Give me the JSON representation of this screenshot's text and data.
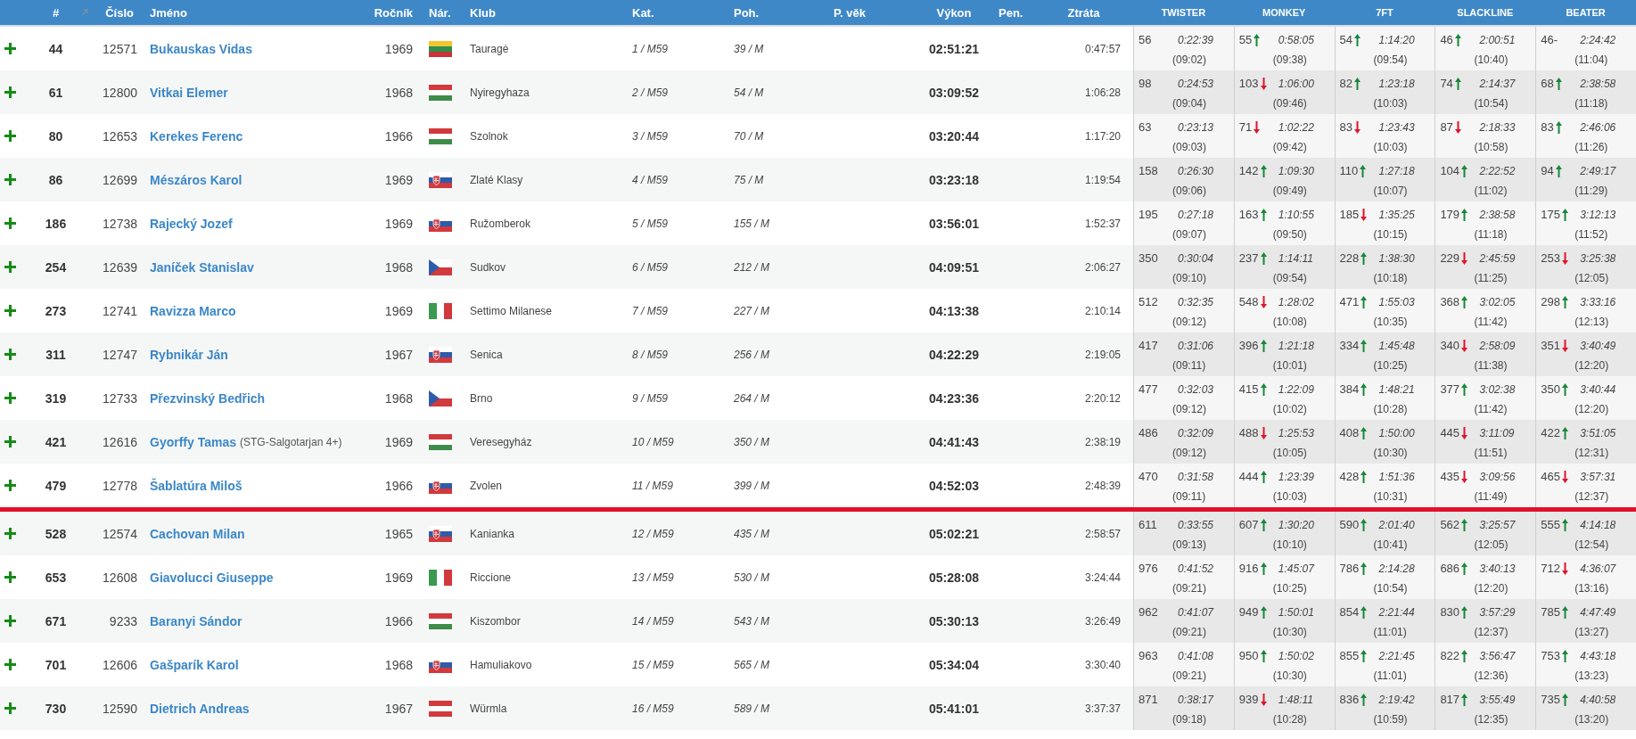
{
  "columns": [
    "#",
    "Číslo",
    "Jméno",
    "Ročník",
    "Nár.",
    "Klub",
    "Kat.",
    "Poh.",
    "P. věk",
    "Výkon",
    "Pen.",
    "Ztráta"
  ],
  "checkpoints": [
    "TWISTER",
    "MONKEY",
    "7FT",
    "SLACKLINE",
    "BEATER"
  ],
  "rows": [
    {
      "kind": "athlete",
      "place": "44",
      "number": "12571",
      "name": "Bukauskas Vidas",
      "year": "1969",
      "flag": {
        "kind": "lithuania"
      },
      "club": "Tauragė",
      "category": "1 / M59",
      "gender": "39 / M",
      "performance": "02:51:21",
      "loss": "0:47:57",
      "splits": [
        {
          "kind": "plain",
          "rank": "56",
          "time": "0:22:39",
          "clock": "(09:02)"
        },
        {
          "kind": "rise",
          "rank": "55",
          "time": "0:58:05",
          "clock": "(09:38)"
        },
        {
          "kind": "rise",
          "rank": "54",
          "time": "1:14:20",
          "clock": "(09:54)"
        },
        {
          "kind": "rise",
          "rank": "46",
          "time": "2:00:51",
          "clock": "(10:40)"
        },
        {
          "kind": "plain",
          "rank": "46-",
          "time": "2:24:42",
          "clock": "(11:04)"
        }
      ]
    },
    {
      "kind": "athlete",
      "place": "61",
      "number": "12800",
      "name": "Vitkai Elemer",
      "year": "1968",
      "flag": {
        "kind": "hungary"
      },
      "club": "Nyiregyhaza",
      "category": "2 / M59",
      "gender": "54 / M",
      "performance": "03:09:52",
      "loss": "1:06:28",
      "splits": [
        {
          "kind": "plain",
          "rank": "98",
          "time": "0:24:53",
          "clock": "(09:04)"
        },
        {
          "kind": "fall",
          "rank": "103",
          "time": "1:06:00",
          "clock": "(09:46)"
        },
        {
          "kind": "rise",
          "rank": "82",
          "time": "1:23:18",
          "clock": "(10:03)"
        },
        {
          "kind": "rise",
          "rank": "74",
          "time": "2:14:37",
          "clock": "(10:54)"
        },
        {
          "kind": "rise",
          "rank": "68",
          "time": "2:38:58",
          "clock": "(11:18)"
        }
      ]
    },
    {
      "kind": "athlete",
      "place": "80",
      "number": "12653",
      "name": "Kerekes Ferenc",
      "year": "1966",
      "flag": {
        "kind": "hungary"
      },
      "club": "Szolnok",
      "category": "3 / M59",
      "gender": "70 / M",
      "performance": "03:20:44",
      "loss": "1:17:20",
      "splits": [
        {
          "kind": "plain",
          "rank": "63",
          "time": "0:23:13",
          "clock": "(09:03)"
        },
        {
          "kind": "fall",
          "rank": "71",
          "time": "1:02:22",
          "clock": "(09:42)"
        },
        {
          "kind": "fall",
          "rank": "83",
          "time": "1:23:43",
          "clock": "(10:03)"
        },
        {
          "kind": "fall",
          "rank": "87",
          "time": "2:18:33",
          "clock": "(10:58)"
        },
        {
          "kind": "rise",
          "rank": "83",
          "time": "2:46:06",
          "clock": "(11:26)"
        }
      ]
    },
    {
      "kind": "athlete",
      "place": "86",
      "number": "12699",
      "name": "Mészáros Karol",
      "year": "1969",
      "flag": {
        "kind": "slovakia"
      },
      "club": "Zlaté Klasy",
      "category": "4 / M59",
      "gender": "75 / M",
      "performance": "03:23:18",
      "loss": "1:19:54",
      "splits": [
        {
          "kind": "plain",
          "rank": "158",
          "time": "0:26:30",
          "clock": "(09:06)"
        },
        {
          "kind": "rise",
          "rank": "142",
          "time": "1:09:30",
          "clock": "(09:49)"
        },
        {
          "kind": "rise",
          "rank": "110",
          "time": "1:27:18",
          "clock": "(10:07)"
        },
        {
          "kind": "rise",
          "rank": "104",
          "time": "2:22:52",
          "clock": "(11:02)"
        },
        {
          "kind": "rise",
          "rank": "94",
          "time": "2:49:17",
          "clock": "(11:29)"
        }
      ]
    },
    {
      "kind": "athlete",
      "place": "186",
      "number": "12738",
      "name": "Rajecký Jozef",
      "year": "1969",
      "flag": {
        "kind": "slovakia"
      },
      "club": "Ružomberok",
      "category": "5 / M59",
      "gender": "155 / M",
      "performance": "03:56:01",
      "loss": "1:52:37",
      "splits": [
        {
          "kind": "plain",
          "rank": "195",
          "time": "0:27:18",
          "clock": "(09:07)"
        },
        {
          "kind": "rise",
          "rank": "163",
          "time": "1:10:55",
          "clock": "(09:50)"
        },
        {
          "kind": "fall",
          "rank": "185",
          "time": "1:35:25",
          "clock": "(10:15)"
        },
        {
          "kind": "rise",
          "rank": "179",
          "time": "2:38:58",
          "clock": "(11:18)"
        },
        {
          "kind": "rise",
          "rank": "175",
          "time": "3:12:13",
          "clock": "(11:52)"
        }
      ]
    },
    {
      "kind": "athlete",
      "place": "254",
      "number": "12639",
      "name": "Janíček Stanislav",
      "year": "1968",
      "flag": {
        "kind": "czechia"
      },
      "club": "Sudkov",
      "category": "6 / M59",
      "gender": "212 / M",
      "performance": "04:09:51",
      "loss": "2:06:27",
      "splits": [
        {
          "kind": "plain",
          "rank": "350",
          "time": "0:30:04",
          "clock": "(09:10)"
        },
        {
          "kind": "rise",
          "rank": "237",
          "time": "1:14:11",
          "clock": "(09:54)"
        },
        {
          "kind": "rise",
          "rank": "228",
          "time": "1:38:30",
          "clock": "(10:18)"
        },
        {
          "kind": "fall",
          "rank": "229",
          "time": "2:45:59",
          "clock": "(11:25)"
        },
        {
          "kind": "fall",
          "rank": "253",
          "time": "3:25:38",
          "clock": "(12:05)"
        }
      ]
    },
    {
      "kind": "athlete",
      "place": "273",
      "number": "12741",
      "name": "Ravizza Marco",
      "year": "1969",
      "flag": {
        "kind": "italy"
      },
      "club": "Settimo Milanese",
      "category": "7 / M59",
      "gender": "227 / M",
      "performance": "04:13:38",
      "loss": "2:10:14",
      "splits": [
        {
          "kind": "plain",
          "rank": "512",
          "time": "0:32:35",
          "clock": "(09:12)"
        },
        {
          "kind": "fall",
          "rank": "548",
          "time": "1:28:02",
          "clock": "(10:08)"
        },
        {
          "kind": "rise",
          "rank": "471",
          "time": "1:55:03",
          "clock": "(10:35)"
        },
        {
          "kind": "rise",
          "rank": "368",
          "time": "3:02:05",
          "clock": "(11:42)"
        },
        {
          "kind": "rise",
          "rank": "298",
          "time": "3:33:16",
          "clock": "(12:13)"
        }
      ]
    },
    {
      "kind": "athlete",
      "place": "311",
      "number": "12747",
      "name": "Rybnikár Ján",
      "year": "1967",
      "flag": {
        "kind": "slovakia"
      },
      "club": "Senica",
      "category": "8 / M59",
      "gender": "256 / M",
      "performance": "04:22:29",
      "loss": "2:19:05",
      "splits": [
        {
          "kind": "plain",
          "rank": "417",
          "time": "0:31:06",
          "clock": "(09:11)"
        },
        {
          "kind": "rise",
          "rank": "396",
          "time": "1:21:18",
          "clock": "(10:01)"
        },
        {
          "kind": "rise",
          "rank": "334",
          "time": "1:45:48",
          "clock": "(10:25)"
        },
        {
          "kind": "fall",
          "rank": "340",
          "time": "2:58:09",
          "clock": "(11:38)"
        },
        {
          "kind": "fall",
          "rank": "351",
          "time": "3:40:49",
          "clock": "(12:20)"
        }
      ]
    },
    {
      "kind": "athlete",
      "place": "319",
      "number": "12733",
      "name": "Přezvinský Bedřich",
      "year": "1968",
      "flag": {
        "kind": "czechia"
      },
      "club": "Brno",
      "category": "9 / M59",
      "gender": "264 / M",
      "performance": "04:23:36",
      "loss": "2:20:12",
      "splits": [
        {
          "kind": "plain",
          "rank": "477",
          "time": "0:32:03",
          "clock": "(09:12)"
        },
        {
          "kind": "rise",
          "rank": "415",
          "time": "1:22:09",
          "clock": "(10:02)"
        },
        {
          "kind": "rise",
          "rank": "384",
          "time": "1:48:21",
          "clock": "(10:28)"
        },
        {
          "kind": "rise",
          "rank": "377",
          "time": "3:02:38",
          "clock": "(11:42)"
        },
        {
          "kind": "rise",
          "rank": "350",
          "time": "3:40:44",
          "clock": "(12:20)"
        }
      ]
    },
    {
      "kind": "athlete",
      "place": "421",
      "number": "12616",
      "name": "Gyorffy Tamas",
      "team": "(STG-Salgotarjan 4+)",
      "year": "1969",
      "flag": {
        "kind": "hungary"
      },
      "club": "Veresegyház",
      "category": "10 / M59",
      "gender": "350 / M",
      "performance": "04:41:43",
      "loss": "2:38:19",
      "splits": [
        {
          "kind": "plain",
          "rank": "486",
          "time": "0:32:09",
          "clock": "(09:12)"
        },
        {
          "kind": "fall",
          "rank": "488",
          "time": "1:25:53",
          "clock": "(10:05)"
        },
        {
          "kind": "rise",
          "rank": "408",
          "time": "1:50:00",
          "clock": "(10:30)"
        },
        {
          "kind": "fall",
          "rank": "445",
          "time": "3:11:09",
          "clock": "(11:51)"
        },
        {
          "kind": "rise",
          "rank": "422",
          "time": "3:51:05",
          "clock": "(12:31)"
        }
      ]
    },
    {
      "kind": "athlete",
      "place": "479",
      "number": "12778",
      "name": "Šablatúra Miloš",
      "year": "1966",
      "flag": {
        "kind": "slovakia"
      },
      "club": "Zvolen",
      "category": "11 / M59",
      "gender": "399 / M",
      "performance": "04:52:03",
      "loss": "2:48:39",
      "splits": [
        {
          "kind": "plain",
          "rank": "470",
          "time": "0:31:58",
          "clock": "(09:11)"
        },
        {
          "kind": "rise",
          "rank": "444",
          "time": "1:23:39",
          "clock": "(10:03)"
        },
        {
          "kind": "rise",
          "rank": "428",
          "time": "1:51:36",
          "clock": "(10:31)"
        },
        {
          "kind": "fall",
          "rank": "435",
          "time": "3:09:56",
          "clock": "(11:49)"
        },
        {
          "kind": "fall",
          "rank": "465",
          "time": "3:57:31",
          "clock": "(12:37)"
        }
      ]
    },
    {
      "kind": "divider"
    },
    {
      "kind": "athlete",
      "place": "528",
      "number": "12574",
      "name": "Cachovan Milan",
      "year": "1965",
      "flag": {
        "kind": "slovakia"
      },
      "club": "Kanianka",
      "category": "12 / M59",
      "gender": "435 / M",
      "performance": "05:02:21",
      "loss": "2:58:57",
      "splits": [
        {
          "kind": "plain",
          "rank": "611",
          "time": "0:33:55",
          "clock": "(09:13)"
        },
        {
          "kind": "rise",
          "rank": "607",
          "time": "1:30:20",
          "clock": "(10:10)"
        },
        {
          "kind": "rise",
          "rank": "590",
          "time": "2:01:40",
          "clock": "(10:41)"
        },
        {
          "kind": "rise",
          "rank": "562",
          "time": "3:25:57",
          "clock": "(12:05)"
        },
        {
          "kind": "rise",
          "rank": "555",
          "time": "4:14:18",
          "clock": "(12:54)"
        }
      ]
    },
    {
      "kind": "athlete",
      "place": "653",
      "number": "12608",
      "name": "Giavolucci Giuseppe",
      "year": "1969",
      "flag": {
        "kind": "italy"
      },
      "club": "Riccione",
      "category": "13 / M59",
      "gender": "530 / M",
      "performance": "05:28:08",
      "loss": "3:24:44",
      "splits": [
        {
          "kind": "plain",
          "rank": "976",
          "time": "0:41:52",
          "clock": "(09:21)"
        },
        {
          "kind": "rise",
          "rank": "916",
          "time": "1:45:07",
          "clock": "(10:25)"
        },
        {
          "kind": "rise",
          "rank": "786",
          "time": "2:14:28",
          "clock": "(10:54)"
        },
        {
          "kind": "rise",
          "rank": "686",
          "time": "3:40:13",
          "clock": "(12:20)"
        },
        {
          "kind": "fall",
          "rank": "712",
          "time": "4:36:07",
          "clock": "(13:16)"
        }
      ]
    },
    {
      "kind": "athlete",
      "place": "671",
      "number": "9233",
      "name": "Baranyi Sándor",
      "year": "1966",
      "flag": {
        "kind": "hungary"
      },
      "club": "Kiszombor",
      "category": "14 / M59",
      "gender": "543 / M",
      "performance": "05:30:13",
      "loss": "3:26:49",
      "splits": [
        {
          "kind": "plain",
          "rank": "962",
          "time": "0:41:07",
          "clock": "(09:21)"
        },
        {
          "kind": "rise",
          "rank": "949",
          "time": "1:50:01",
          "clock": "(10:30)"
        },
        {
          "kind": "rise",
          "rank": "854",
          "time": "2:21:44",
          "clock": "(11:01)"
        },
        {
          "kind": "rise",
          "rank": "830",
          "time": "3:57:29",
          "clock": "(12:37)"
        },
        {
          "kind": "rise",
          "rank": "785",
          "time": "4:47:49",
          "clock": "(13:27)"
        }
      ]
    },
    {
      "kind": "athlete",
      "place": "701",
      "number": "12606",
      "name": "Gašparík Karol",
      "year": "1968",
      "flag": {
        "kind": "slovakia"
      },
      "club": "Hamuliakovo",
      "category": "15 / M59",
      "gender": "565 / M",
      "performance": "05:34:04",
      "loss": "3:30:40",
      "splits": [
        {
          "kind": "plain",
          "rank": "963",
          "time": "0:41:08",
          "clock": "(09:21)"
        },
        {
          "kind": "rise",
          "rank": "950",
          "time": "1:50:02",
          "clock": "(10:30)"
        },
        {
          "kind": "rise",
          "rank": "855",
          "time": "2:21:45",
          "clock": "(11:01)"
        },
        {
          "kind": "rise",
          "rank": "822",
          "time": "3:56:47",
          "clock": "(12:36)"
        },
        {
          "kind": "rise",
          "rank": "753",
          "time": "4:43:18",
          "clock": "(13:23)"
        }
      ]
    },
    {
      "kind": "athlete",
      "place": "730",
      "number": "12590",
      "name": "Dietrich Andreas",
      "year": "1967",
      "flag": {
        "kind": "austria"
      },
      "club": "Würmla",
      "category": "16 / M59",
      "gender": "589 / M",
      "performance": "05:41:01",
      "loss": "3:37:37",
      "splits": [
        {
          "kind": "plain",
          "rank": "871",
          "time": "0:38:17",
          "clock": "(09:18)"
        },
        {
          "kind": "fall",
          "rank": "939",
          "time": "1:48:11",
          "clock": "(10:28)"
        },
        {
          "kind": "rise",
          "rank": "836",
          "time": "2:19:42",
          "clock": "(10:59)"
        },
        {
          "kind": "rise",
          "rank": "817",
          "time": "3:55:49",
          "clock": "(12:35)"
        },
        {
          "kind": "rise",
          "rank": "735",
          "time": "4:40:58",
          "clock": "(13:20)"
        }
      ]
    }
  ]
}
